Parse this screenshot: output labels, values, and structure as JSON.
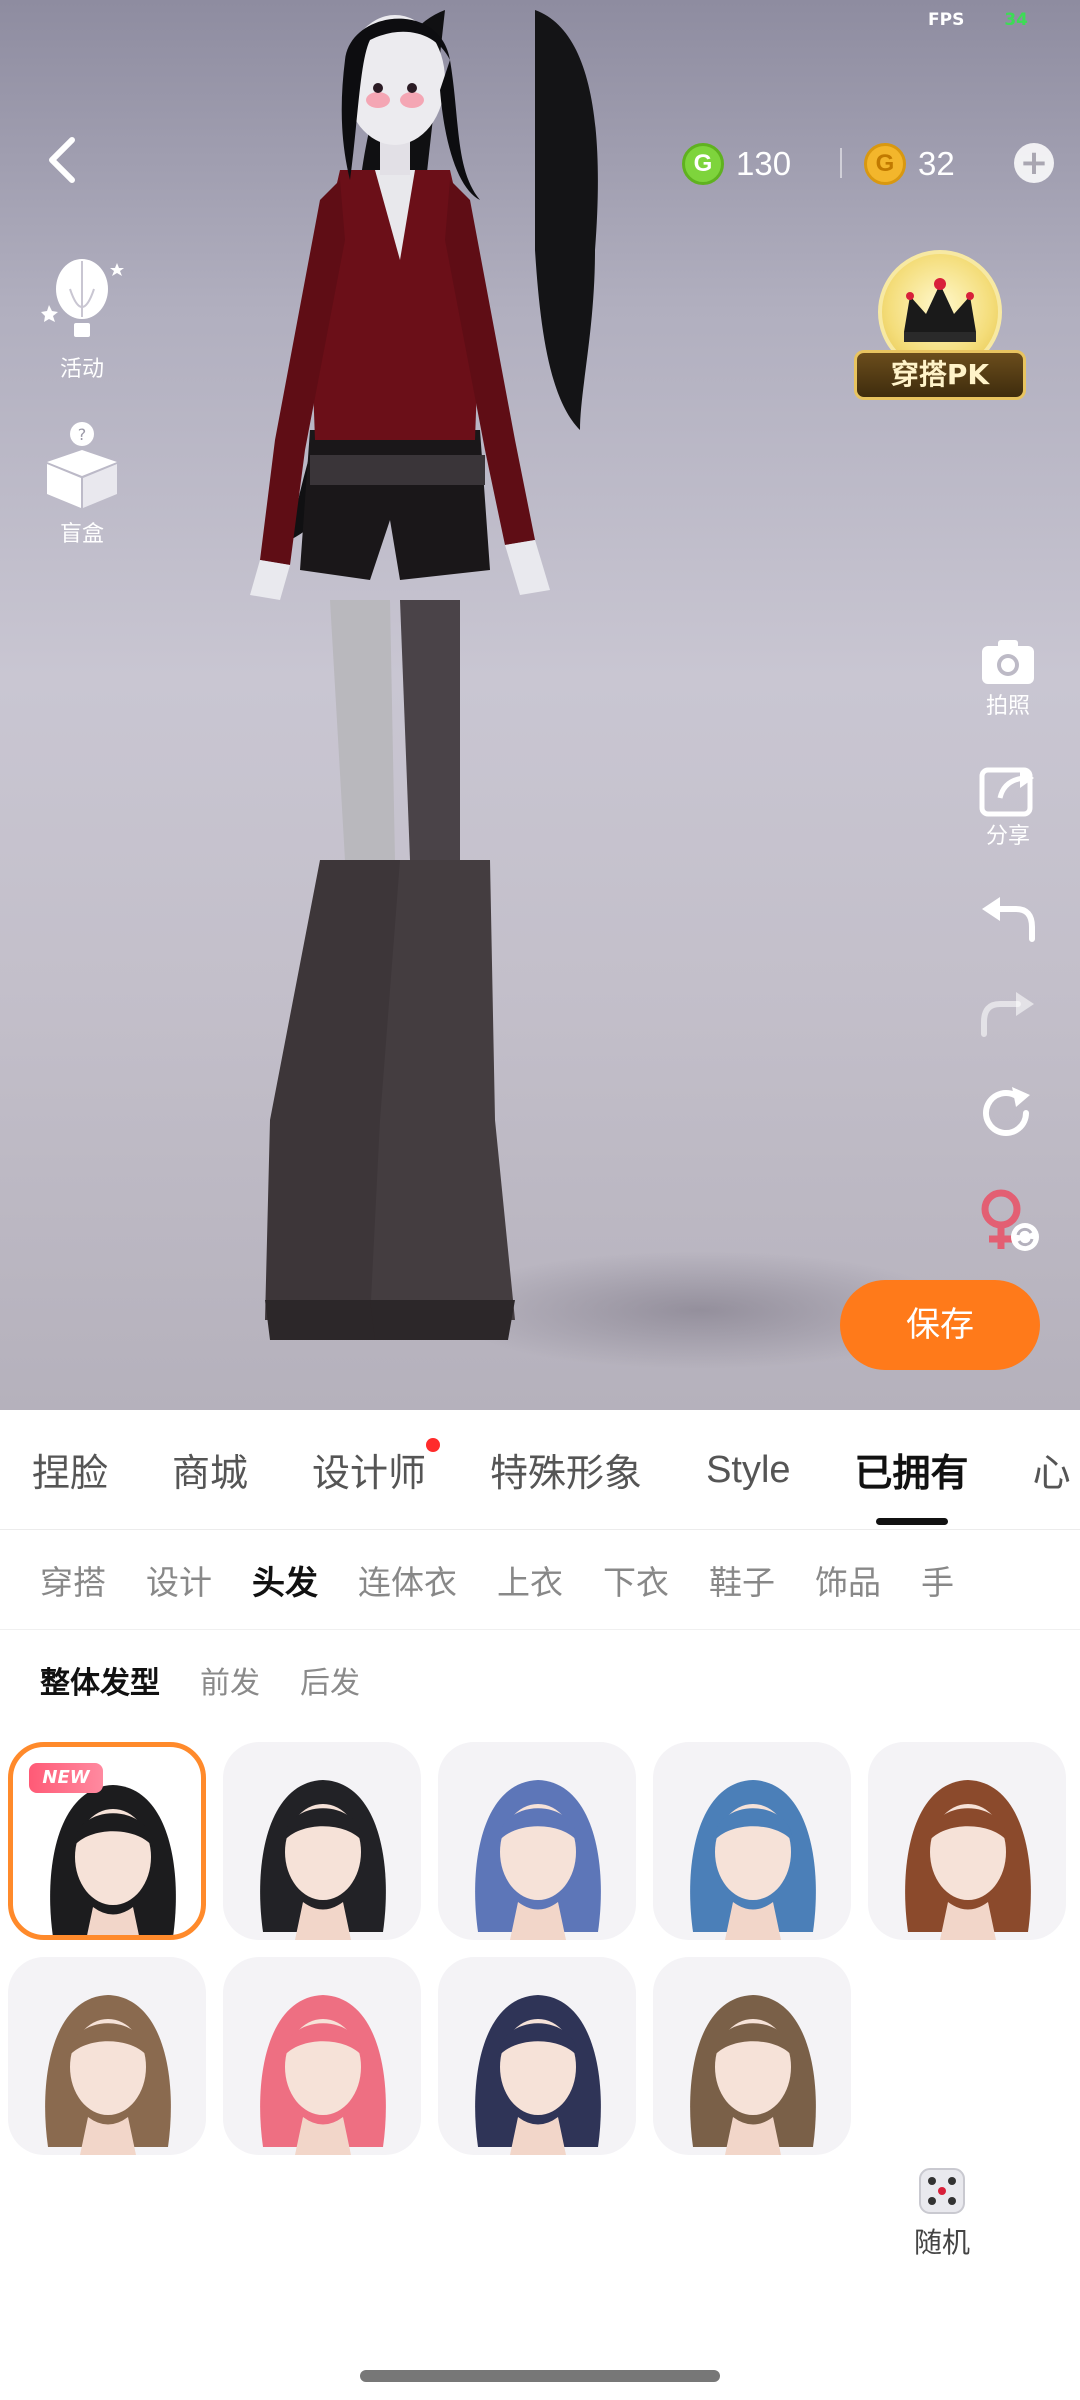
{
  "status": {
    "fps_label": "FPS",
    "fps_value": "34"
  },
  "currency": {
    "green_coin_symbol": "G",
    "green_amount": "130",
    "gold_coin_symbol": "G",
    "gold_amount": "32",
    "add": "+"
  },
  "left_menu": [
    {
      "label": "活动",
      "icon": "hot-air-balloon-icon"
    },
    {
      "label": "盲盒",
      "icon": "mystery-box-icon"
    }
  ],
  "pk_badge": {
    "label": "穿搭PK",
    "icon": "crown-icon"
  },
  "right_tools": {
    "camera_label": "拍照",
    "share_label": "分享"
  },
  "save_label": "保存",
  "main_tabs": [
    {
      "label": "捏脸",
      "active": false,
      "dot": false
    },
    {
      "label": "商城",
      "active": false,
      "dot": false
    },
    {
      "label": "设计师",
      "active": false,
      "dot": true
    },
    {
      "label": "特殊形象",
      "active": false,
      "dot": false
    },
    {
      "label": "Style",
      "active": false,
      "dot": false
    },
    {
      "label": "已拥有",
      "active": true,
      "dot": false
    },
    {
      "label": "心",
      "active": false,
      "dot": false
    }
  ],
  "sub_tabs": [
    {
      "label": "穿搭",
      "active": false
    },
    {
      "label": "设计",
      "active": false
    },
    {
      "label": "头发",
      "active": true
    },
    {
      "label": "连体衣",
      "active": false
    },
    {
      "label": "上衣",
      "active": false
    },
    {
      "label": "下衣",
      "active": false
    },
    {
      "label": "鞋子",
      "active": false
    },
    {
      "label": "饰品",
      "active": false
    },
    {
      "label": "手",
      "active": false
    }
  ],
  "style_tabs": [
    {
      "label": "整体发型",
      "active": true
    },
    {
      "label": "前发",
      "active": false
    },
    {
      "label": "后发",
      "active": false
    }
  ],
  "hair_items": [
    {
      "name": "long-black-hair",
      "selected": true,
      "new": true,
      "hair_color": "#1c1c1e"
    },
    {
      "name": "black-hair-cat-beanie",
      "selected": false,
      "new": false,
      "hair_color": "#222226"
    },
    {
      "name": "blue-silver-bob",
      "selected": false,
      "new": false,
      "hair_color": "#5d76b8"
    },
    {
      "name": "blue-long-hair",
      "selected": false,
      "new": false,
      "hair_color": "#4b7fb8"
    },
    {
      "name": "brown-bob-headband",
      "selected": false,
      "new": false,
      "hair_color": "#8b4a2c"
    },
    {
      "name": "brown-side-ponytail",
      "selected": false,
      "new": false,
      "hair_color": "#8a6a4f"
    },
    {
      "name": "pink-braids-tiara",
      "selected": false,
      "new": false,
      "hair_color": "#ee6f82"
    },
    {
      "name": "navy-short-messy",
      "selected": false,
      "new": false,
      "hair_color": "#2f3457"
    },
    {
      "name": "brown-updo-ornament",
      "selected": false,
      "new": false,
      "hair_color": "#7a6048"
    }
  ],
  "new_badge": "NEW",
  "random_label": "随机",
  "colors": {
    "accent_orange": "#ff7a1a",
    "selected_border": "#ff8a2b",
    "notification_dot": "#ff2b2b"
  }
}
